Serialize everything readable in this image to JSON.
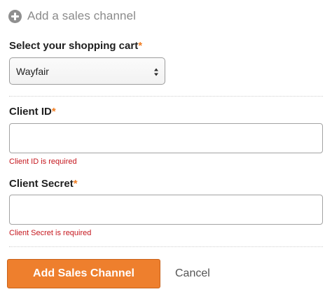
{
  "header": {
    "icon": "plus-circle-icon",
    "title": "Add a sales channel"
  },
  "form": {
    "cart": {
      "label": "Select your shopping cart",
      "required_mark": "*",
      "selected": "Wayfair"
    },
    "client_id": {
      "label": "Client ID",
      "required_mark": "*",
      "value": "",
      "error": "Client ID is required"
    },
    "client_secret": {
      "label": "Client Secret",
      "required_mark": "*",
      "value": "",
      "error": "Client Secret is required"
    }
  },
  "actions": {
    "submit_label": "Add Sales Channel",
    "cancel_label": "Cancel"
  },
  "colors": {
    "accent": "#ee7f2d",
    "required": "#f07d22",
    "error": "#c5161d"
  }
}
